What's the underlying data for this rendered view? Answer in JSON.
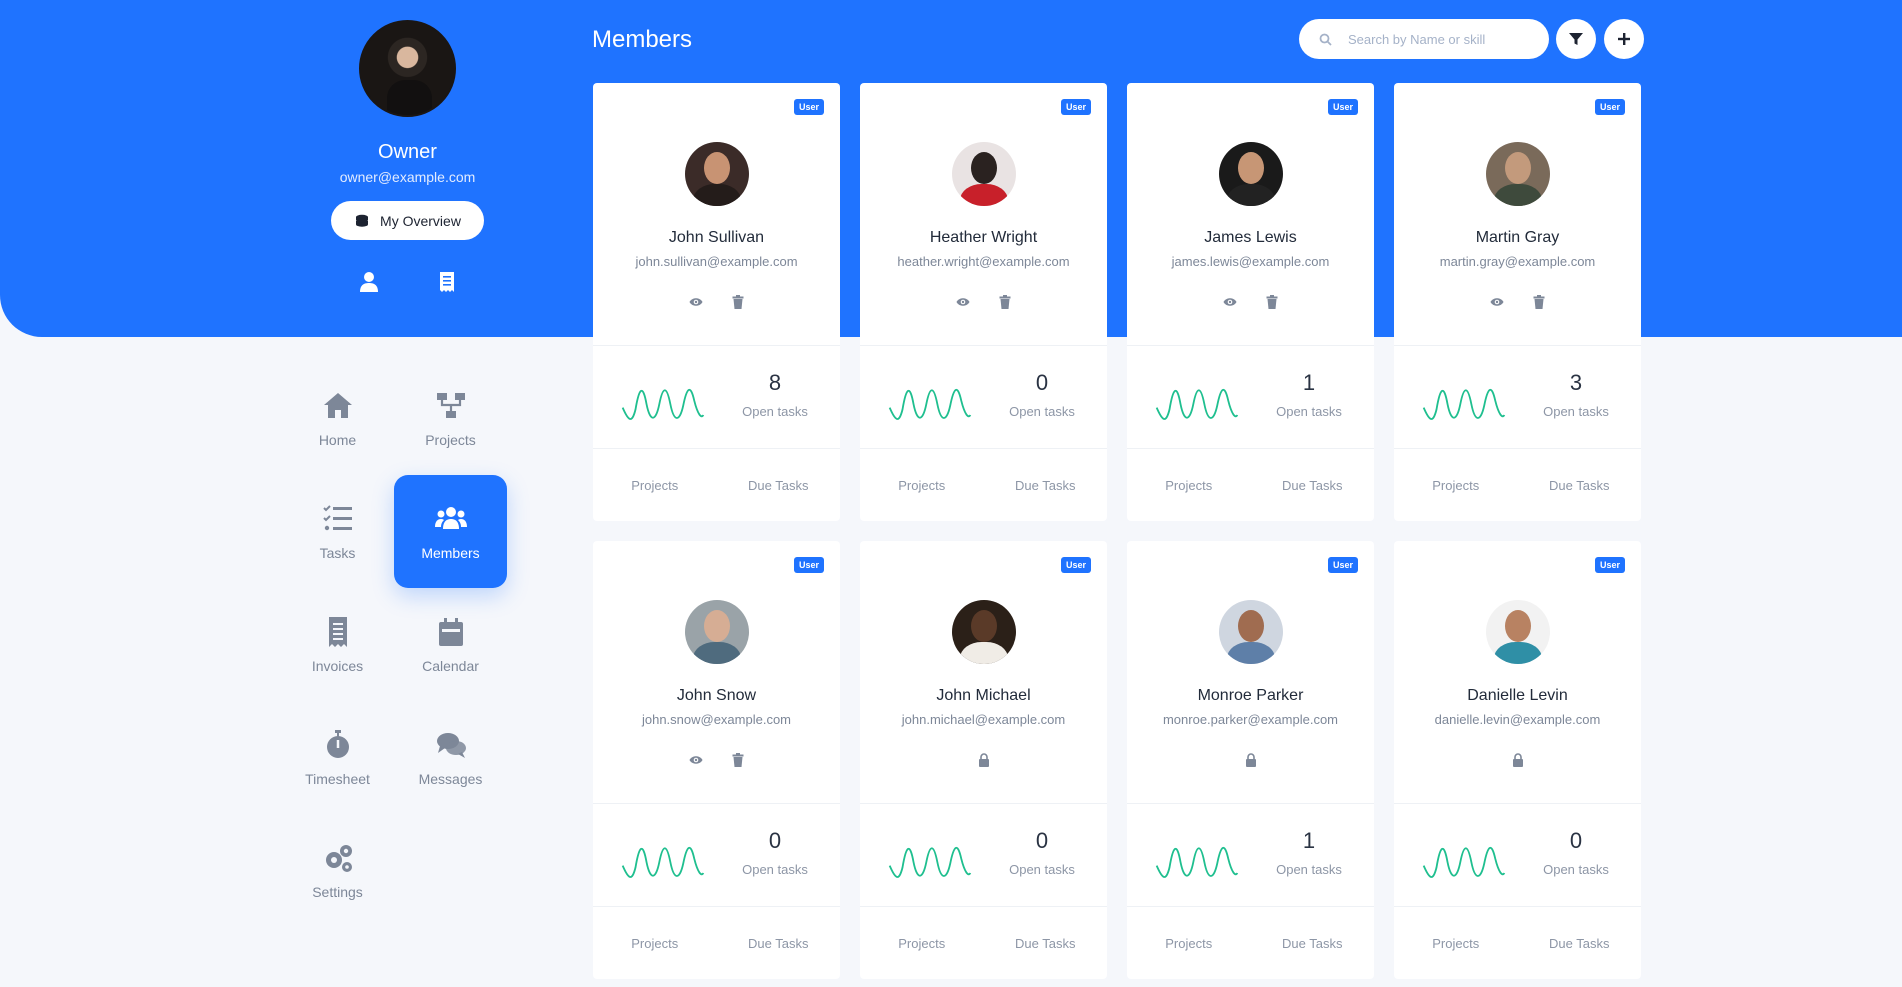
{
  "page": {
    "title": "Members"
  },
  "profile": {
    "name": "Owner",
    "email": "owner@example.com",
    "overview_label": "My Overview",
    "icons": [
      "user-icon",
      "receipt-icon"
    ]
  },
  "search": {
    "placeholder": "Search by Name or skill"
  },
  "header_buttons": [
    "filter-icon",
    "plus-icon"
  ],
  "nav": [
    {
      "label": "Home",
      "icon": "home-icon",
      "active": false
    },
    {
      "label": "Projects",
      "icon": "sitemap-icon",
      "active": false
    },
    {
      "label": "Tasks",
      "icon": "tasks-icon",
      "active": false
    },
    {
      "label": "Members",
      "icon": "users-icon",
      "active": true
    },
    {
      "label": "Invoices",
      "icon": "receipt-icon",
      "active": false
    },
    {
      "label": "Calendar",
      "icon": "calendar-icon",
      "active": false
    },
    {
      "label": "Timesheet",
      "icon": "stopwatch-icon",
      "active": false
    },
    {
      "label": "Messages",
      "icon": "comments-icon",
      "active": false
    },
    {
      "label": "Settings",
      "icon": "cogs-icon",
      "active": false
    }
  ],
  "card_labels": {
    "badge": "User",
    "open_tasks": "Open tasks",
    "projects": "Projects",
    "due_tasks": "Due Tasks"
  },
  "members": [
    {
      "name": "John Sullivan",
      "email": "john.sullivan@example.com",
      "open_tasks": "8",
      "role": "User",
      "locked": false
    },
    {
      "name": "Heather Wright",
      "email": "heather.wright@example.com",
      "open_tasks": "0",
      "role": "User",
      "locked": false
    },
    {
      "name": "James Lewis",
      "email": "james.lewis@example.com",
      "open_tasks": "1",
      "role": "User",
      "locked": false
    },
    {
      "name": "Martin Gray",
      "email": "martin.gray@example.com",
      "open_tasks": "3",
      "role": "User",
      "locked": false
    },
    {
      "name": "John Snow",
      "email": "john.snow@example.com",
      "open_tasks": "0",
      "role": "User",
      "locked": false
    },
    {
      "name": "John Michael",
      "email": "john.michael@example.com",
      "open_tasks": "0",
      "role": "User",
      "locked": true
    },
    {
      "name": "Monroe Parker",
      "email": "monroe.parker@example.com",
      "open_tasks": "1",
      "role": "User",
      "locked": true
    },
    {
      "name": "Danielle Levin",
      "email": "danielle.levin@example.com",
      "open_tasks": "0",
      "role": "User",
      "locked": true
    }
  ],
  "colors": {
    "primary": "#1f73ff",
    "sparkline": "#1fbf8f",
    "icon": "#7d8798"
  }
}
